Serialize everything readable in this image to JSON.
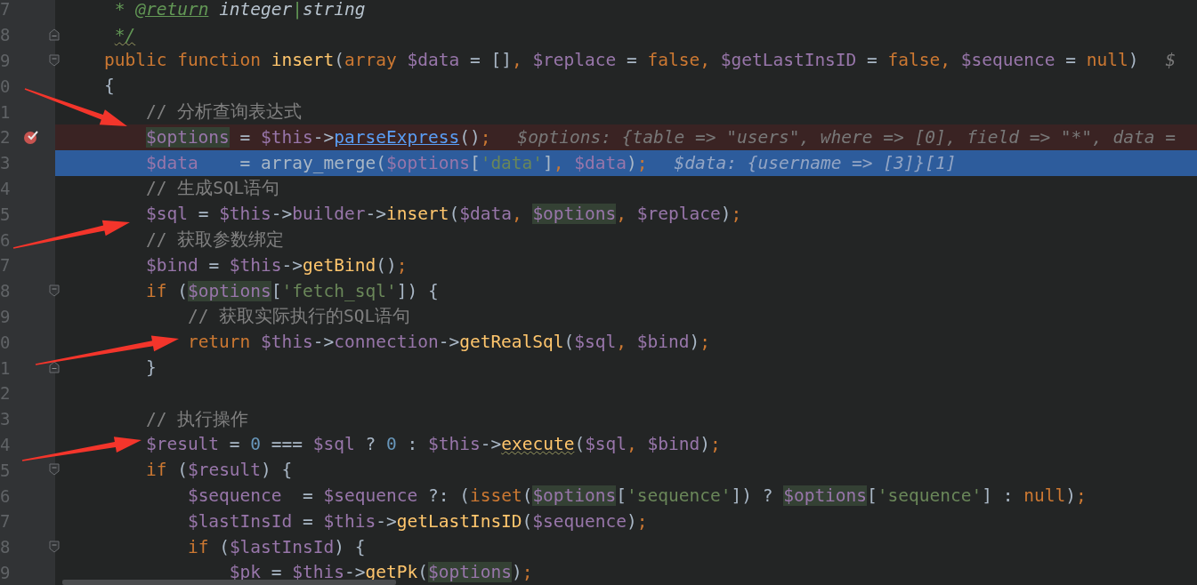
{
  "editor": {
    "lines": [
      {
        "number": "7",
        "breakpoint": false,
        "current": false,
        "fold_open": false,
        "fold_close": false,
        "tokens": [
          {
            "kind": "doc",
            "text": "     * "
          },
          {
            "kind": "doc_tag",
            "text": "@return"
          },
          {
            "kind": "doc_type",
            "text": " integer"
          },
          {
            "kind": "doc",
            "text": "|"
          },
          {
            "kind": "doc_type",
            "text": "string"
          }
        ]
      },
      {
        "number": "8",
        "breakpoint": false,
        "current": false,
        "fold_open": false,
        "fold_close": true,
        "tokens": [
          {
            "kind": "doc_warn",
            "text": "     */"
          }
        ]
      },
      {
        "number": "9",
        "breakpoint": false,
        "current": false,
        "fold_open": true,
        "fold_close": false,
        "tokens": [
          {
            "kind": "keyword",
            "text": "    public function "
          },
          {
            "kind": "func",
            "text": "insert"
          },
          {
            "kind": "plain",
            "text": "("
          },
          {
            "kind": "keyword",
            "text": "array "
          },
          {
            "kind": "var",
            "text": "$data"
          },
          {
            "kind": "plain",
            "text": " = []"
          },
          {
            "kind": "sep",
            "text": ", "
          },
          {
            "kind": "var",
            "text": "$replace"
          },
          {
            "kind": "plain",
            "text": " = "
          },
          {
            "kind": "keyword",
            "text": "false"
          },
          {
            "kind": "sep",
            "text": ", "
          },
          {
            "kind": "var",
            "text": "$getLastInsID"
          },
          {
            "kind": "plain",
            "text": " = "
          },
          {
            "kind": "keyword",
            "text": "false"
          },
          {
            "kind": "sep",
            "text": ", "
          },
          {
            "kind": "var",
            "text": "$sequence"
          },
          {
            "kind": "plain",
            "text": " = "
          },
          {
            "kind": "keyword",
            "text": "null"
          },
          {
            "kind": "plain",
            "text": ")"
          }
        ],
        "hint": "$"
      },
      {
        "number": "0",
        "breakpoint": false,
        "current": false,
        "fold_open": false,
        "fold_close": false,
        "tokens": [
          {
            "kind": "plain",
            "text": "    {"
          }
        ]
      },
      {
        "number": "1",
        "breakpoint": false,
        "current": false,
        "fold_open": false,
        "fold_close": false,
        "tokens": [
          {
            "kind": "comment",
            "text": "        // 分析查询表达式"
          }
        ]
      },
      {
        "number": "2",
        "breakpoint": true,
        "current": false,
        "fold_open": false,
        "fold_close": false,
        "tokens": [
          {
            "kind": "var_hl",
            "text": "        $options"
          },
          {
            "kind": "plain",
            "text": " = "
          },
          {
            "kind": "var",
            "text": "$this"
          },
          {
            "kind": "plain",
            "text": "->"
          },
          {
            "kind": "func_link",
            "text": "parseExpress"
          },
          {
            "kind": "plain",
            "text": "()"
          },
          {
            "kind": "sep",
            "text": ";"
          }
        ],
        "hint": "$options: {table => \"users\", where => [0], field => \"*\", data ="
      },
      {
        "number": "3",
        "breakpoint": false,
        "current": true,
        "fold_open": false,
        "fold_close": false,
        "tokens": [
          {
            "kind": "var",
            "text": "        $data"
          },
          {
            "kind": "plain",
            "text": "    = array_merge("
          },
          {
            "kind": "var",
            "text": "$options"
          },
          {
            "kind": "plain",
            "text": "["
          },
          {
            "kind": "string",
            "text": "'data'"
          },
          {
            "kind": "plain",
            "text": "]"
          },
          {
            "kind": "sep",
            "text": ", "
          },
          {
            "kind": "var",
            "text": "$data"
          },
          {
            "kind": "plain",
            "text": ")"
          },
          {
            "kind": "sep",
            "text": ";"
          }
        ],
        "hint": "$data: {username => [3]}[1]"
      },
      {
        "number": "4",
        "breakpoint": false,
        "current": false,
        "fold_open": false,
        "fold_close": false,
        "tokens": [
          {
            "kind": "comment",
            "text": "        // 生成SQL语句"
          }
        ]
      },
      {
        "number": "5",
        "breakpoint": false,
        "current": false,
        "fold_open": false,
        "fold_close": false,
        "tokens": [
          {
            "kind": "var",
            "text": "        $sql"
          },
          {
            "kind": "plain",
            "text": " = "
          },
          {
            "kind": "var",
            "text": "$this"
          },
          {
            "kind": "plain",
            "text": "->"
          },
          {
            "kind": "var",
            "text": "builder"
          },
          {
            "kind": "plain",
            "text": "->"
          },
          {
            "kind": "func",
            "text": "insert"
          },
          {
            "kind": "plain",
            "text": "("
          },
          {
            "kind": "var",
            "text": "$data"
          },
          {
            "kind": "sep",
            "text": ", "
          },
          {
            "kind": "var_hl",
            "text": "$options"
          },
          {
            "kind": "sep",
            "text": ", "
          },
          {
            "kind": "var",
            "text": "$replace"
          },
          {
            "kind": "plain",
            "text": ")"
          },
          {
            "kind": "sep",
            "text": ";"
          }
        ]
      },
      {
        "number": "6",
        "breakpoint": false,
        "current": false,
        "fold_open": false,
        "fold_close": false,
        "tokens": [
          {
            "kind": "comment",
            "text": "        // 获取参数绑定"
          }
        ]
      },
      {
        "number": "7",
        "breakpoint": false,
        "current": false,
        "fold_open": false,
        "fold_close": false,
        "tokens": [
          {
            "kind": "var",
            "text": "        $bind"
          },
          {
            "kind": "plain",
            "text": " = "
          },
          {
            "kind": "var",
            "text": "$this"
          },
          {
            "kind": "plain",
            "text": "->"
          },
          {
            "kind": "func",
            "text": "getBind"
          },
          {
            "kind": "plain",
            "text": "()"
          },
          {
            "kind": "sep",
            "text": ";"
          }
        ]
      },
      {
        "number": "8",
        "breakpoint": false,
        "current": false,
        "fold_open": true,
        "fold_close": false,
        "tokens": [
          {
            "kind": "keyword",
            "text": "        if "
          },
          {
            "kind": "plain",
            "text": "("
          },
          {
            "kind": "var_hl",
            "text": "$options"
          },
          {
            "kind": "plain",
            "text": "["
          },
          {
            "kind": "string",
            "text": "'fetch_sql'"
          },
          {
            "kind": "plain",
            "text": "]) {"
          }
        ]
      },
      {
        "number": "9",
        "breakpoint": false,
        "current": false,
        "fold_open": false,
        "fold_close": false,
        "tokens": [
          {
            "kind": "comment",
            "text": "            // 获取实际执行的SQL语句"
          }
        ]
      },
      {
        "number": "0",
        "breakpoint": false,
        "current": false,
        "fold_open": false,
        "fold_close": false,
        "tokens": [
          {
            "kind": "keyword",
            "text": "            return "
          },
          {
            "kind": "var",
            "text": "$this"
          },
          {
            "kind": "plain",
            "text": "->"
          },
          {
            "kind": "var",
            "text": "connection"
          },
          {
            "kind": "plain",
            "text": "->"
          },
          {
            "kind": "func",
            "text": "getRealSql"
          },
          {
            "kind": "plain",
            "text": "("
          },
          {
            "kind": "var",
            "text": "$sql"
          },
          {
            "kind": "sep",
            "text": ", "
          },
          {
            "kind": "var",
            "text": "$bind"
          },
          {
            "kind": "plain",
            "text": ")"
          },
          {
            "kind": "sep",
            "text": ";"
          }
        ]
      },
      {
        "number": "1",
        "breakpoint": false,
        "current": false,
        "fold_open": false,
        "fold_close": true,
        "tokens": [
          {
            "kind": "plain",
            "text": "        }"
          }
        ]
      },
      {
        "number": "2",
        "breakpoint": false,
        "current": false,
        "fold_open": false,
        "fold_close": false
      },
      {
        "number": "3",
        "breakpoint": false,
        "current": false,
        "fold_open": false,
        "fold_close": false,
        "tokens": [
          {
            "kind": "comment",
            "text": "        // 执行操作"
          }
        ]
      },
      {
        "number": "4",
        "breakpoint": false,
        "current": false,
        "fold_open": false,
        "fold_close": false,
        "tokens": [
          {
            "kind": "var",
            "text": "        $result"
          },
          {
            "kind": "plain",
            "text": " = "
          },
          {
            "kind": "number",
            "text": "0"
          },
          {
            "kind": "plain",
            "text": " === "
          },
          {
            "kind": "var",
            "text": "$sql"
          },
          {
            "kind": "plain",
            "text": " ? "
          },
          {
            "kind": "number",
            "text": "0"
          },
          {
            "kind": "plain",
            "text": " : "
          },
          {
            "kind": "var",
            "text": "$this"
          },
          {
            "kind": "plain",
            "text": "->"
          },
          {
            "kind": "func_warn",
            "text": "execute"
          },
          {
            "kind": "plain",
            "text": "("
          },
          {
            "kind": "var",
            "text": "$sql"
          },
          {
            "kind": "sep",
            "text": ", "
          },
          {
            "kind": "var",
            "text": "$bind"
          },
          {
            "kind": "plain",
            "text": ")"
          },
          {
            "kind": "sep",
            "text": ";"
          }
        ]
      },
      {
        "number": "5",
        "breakpoint": false,
        "current": false,
        "fold_open": true,
        "fold_close": false,
        "tokens": [
          {
            "kind": "keyword",
            "text": "        if "
          },
          {
            "kind": "plain",
            "text": "("
          },
          {
            "kind": "var",
            "text": "$result"
          },
          {
            "kind": "plain",
            "text": ") {"
          }
        ]
      },
      {
        "number": "6",
        "breakpoint": false,
        "current": false,
        "fold_open": false,
        "fold_close": false,
        "tokens": [
          {
            "kind": "var",
            "text": "            $sequence"
          },
          {
            "kind": "plain",
            "text": "  = "
          },
          {
            "kind": "var",
            "text": "$sequence"
          },
          {
            "kind": "plain",
            "text": " ?: ("
          },
          {
            "kind": "keyword",
            "text": "isset"
          },
          {
            "kind": "plain",
            "text": "("
          },
          {
            "kind": "var_hl",
            "text": "$options"
          },
          {
            "kind": "plain",
            "text": "["
          },
          {
            "kind": "string",
            "text": "'sequence'"
          },
          {
            "kind": "plain",
            "text": "]) ? "
          },
          {
            "kind": "var_hl",
            "text": "$options"
          },
          {
            "kind": "plain",
            "text": "["
          },
          {
            "kind": "string",
            "text": "'sequence'"
          },
          {
            "kind": "plain",
            "text": "] : "
          },
          {
            "kind": "keyword",
            "text": "null"
          },
          {
            "kind": "plain",
            "text": ")"
          },
          {
            "kind": "sep",
            "text": ";"
          }
        ]
      },
      {
        "number": "7",
        "breakpoint": false,
        "current": false,
        "fold_open": false,
        "fold_close": false,
        "tokens": [
          {
            "kind": "var",
            "text": "            $lastInsId"
          },
          {
            "kind": "plain",
            "text": " = "
          },
          {
            "kind": "var",
            "text": "$this"
          },
          {
            "kind": "plain",
            "text": "->"
          },
          {
            "kind": "func",
            "text": "getLastInsID"
          },
          {
            "kind": "plain",
            "text": "("
          },
          {
            "kind": "var",
            "text": "$sequence"
          },
          {
            "kind": "plain",
            "text": ")"
          },
          {
            "kind": "sep",
            "text": ";"
          }
        ]
      },
      {
        "number": "8",
        "breakpoint": false,
        "current": false,
        "fold_open": true,
        "fold_close": false,
        "tokens": [
          {
            "kind": "keyword",
            "text": "            if "
          },
          {
            "kind": "plain",
            "text": "("
          },
          {
            "kind": "var",
            "text": "$lastInsId"
          },
          {
            "kind": "plain",
            "text": ") {"
          }
        ]
      },
      {
        "number": "9",
        "breakpoint": false,
        "current": false,
        "fold_open": false,
        "fold_close": false,
        "tokens": [
          {
            "kind": "var",
            "text": "                $pk"
          },
          {
            "kind": "plain",
            "text": " = "
          },
          {
            "kind": "var",
            "text": "$this"
          },
          {
            "kind": "plain",
            "text": "->"
          },
          {
            "kind": "func",
            "text": "getPk"
          },
          {
            "kind": "plain",
            "text": "("
          },
          {
            "kind": "var_hl",
            "text": "$options"
          },
          {
            "kind": "plain",
            "text": ")"
          },
          {
            "kind": "sep",
            "text": ";"
          }
        ]
      }
    ]
  }
}
